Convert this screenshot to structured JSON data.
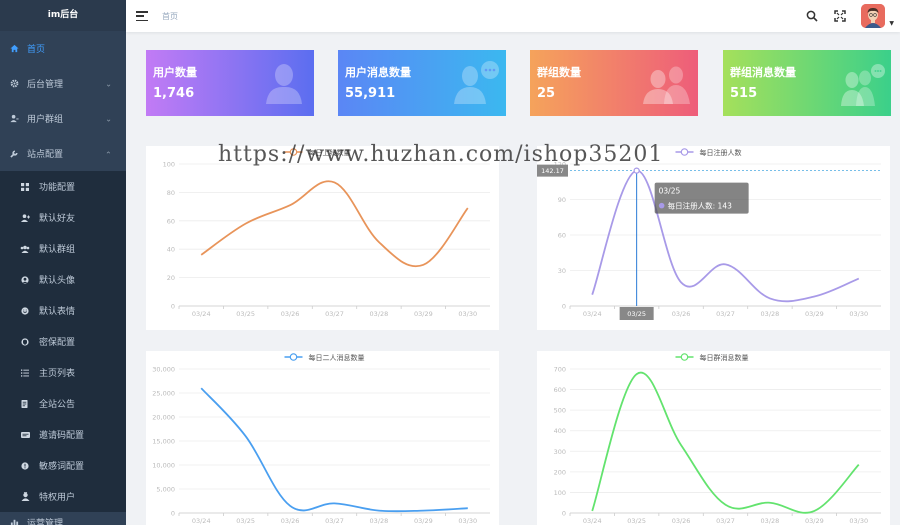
{
  "app": {
    "logo": "im后台"
  },
  "sidebar": {
    "items": [
      {
        "label": "首页",
        "icon": "home-icon",
        "active": true
      },
      {
        "label": "后台管理",
        "icon": "gear-icon",
        "expandable": true
      },
      {
        "label": "用户群组",
        "icon": "user-icon",
        "expandable": true
      },
      {
        "label": "站点配置",
        "icon": "wrench-icon",
        "expanded": true
      }
    ],
    "subitems": [
      {
        "label": "功能配置",
        "icon": "grid-icon"
      },
      {
        "label": "默认好友",
        "icon": "user-add-icon"
      },
      {
        "label": "默认群组",
        "icon": "group-icon"
      },
      {
        "label": "默认头像",
        "icon": "face-icon"
      },
      {
        "label": "默认表情",
        "icon": "smile-icon"
      },
      {
        "label": "密保配置",
        "icon": "shield-icon"
      },
      {
        "label": "主页列表",
        "icon": "list-icon"
      },
      {
        "label": "全站公告",
        "icon": "notice-icon"
      },
      {
        "label": "邀请码配置",
        "icon": "ticket-icon"
      },
      {
        "label": "敏感词配置",
        "icon": "warning-icon"
      },
      {
        "label": "特权用户",
        "icon": "vip-icon"
      }
    ],
    "last_item": {
      "label": "运营管理",
      "icon": "chart-icon"
    }
  },
  "header": {
    "breadcrumb": "首页",
    "icons": [
      "search-icon",
      "fullscreen-icon"
    ],
    "avatar": "avatar"
  },
  "stats": [
    {
      "title": "用户数量",
      "value": "1,746",
      "from": "#c27bf5",
      "to": "#5b6ef0"
    },
    {
      "title": "用户消息数量",
      "value": "55,911",
      "from": "#5b86f5",
      "to": "#3bb8f0"
    },
    {
      "title": "群组数量",
      "value": "25",
      "from": "#f5a35b",
      "to": "#ee5d7a"
    },
    {
      "title": "群组消息数量",
      "value": "515",
      "from": "#a5e05b",
      "to": "#3bd08a"
    }
  ],
  "watermark": "https://www.huzhan.com/ishop35201",
  "chart_data": [
    {
      "type": "line",
      "series": [
        {
          "name": "每日上线数量",
          "values": [
            36,
            58,
            71,
            87,
            45,
            29,
            69
          ]
        }
      ],
      "categories": [
        "03/24",
        "03/25",
        "03/26",
        "03/27",
        "03/28",
        "03/29",
        "03/30"
      ],
      "yticks": [
        "0",
        "20",
        "40",
        "60",
        "80",
        "100"
      ],
      "ylim": [
        0,
        100
      ],
      "color": "#e8945a"
    },
    {
      "type": "line",
      "series": [
        {
          "name": "每日注册人数",
          "values": [
            12,
            143,
            25,
            44,
            8,
            10,
            29
          ]
        }
      ],
      "categories": [
        "03/24",
        "03/25",
        "03/26",
        "03/27",
        "03/28",
        "03/29",
        "03/30"
      ],
      "yticks": [
        "0",
        "30",
        "60",
        "90",
        "120"
      ],
      "ylim": [
        0,
        150
      ],
      "color": "#a89ae8",
      "tooltip": {
        "title": "03/25",
        "text": "每日注册人数: 143",
        "axis_value": "142.17",
        "axis_label": "03/25"
      }
    },
    {
      "type": "line",
      "series": [
        {
          "name": "每日二人消息数量",
          "values": [
            26000,
            16000,
            1500,
            2000,
            500,
            500,
            1000
          ]
        }
      ],
      "categories": [
        "03/24",
        "03/25",
        "03/26",
        "03/27",
        "03/28",
        "03/29",
        "03/30"
      ],
      "yticks": [
        "0",
        "5,000",
        "10,000",
        "15,000",
        "20,000",
        "25,000",
        "30,000"
      ],
      "ylim": [
        0,
        30000
      ],
      "color": "#4a9ff0"
    },
    {
      "type": "line",
      "series": [
        {
          "name": "每日群消息数量",
          "values": [
            10,
            675,
            330,
            40,
            50,
            10,
            235
          ]
        }
      ],
      "categories": [
        "03/24",
        "03/25",
        "03/26",
        "03/27",
        "03/28",
        "03/29",
        "03/30"
      ],
      "yticks": [
        "0",
        "100",
        "200",
        "300",
        "400",
        "500",
        "600",
        "700"
      ],
      "ylim": [
        0,
        700
      ],
      "color": "#63e36e"
    }
  ]
}
